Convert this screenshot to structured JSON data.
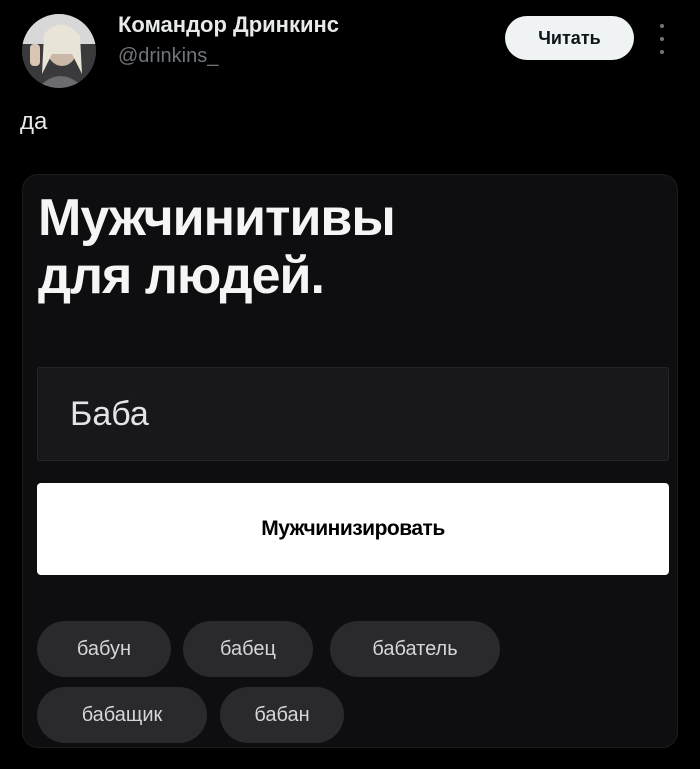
{
  "author": {
    "name": "Командор Дринкинс",
    "handle": "@drinkins_"
  },
  "follow_button_label": "Читать",
  "tweet_text": "да",
  "card": {
    "heading_line1": "Мужчинитивы",
    "heading_line2": "для людей.",
    "input_value": "Баба",
    "submit_label": "Мужчинизировать",
    "suggestions": [
      "бабун",
      "бабец",
      "бабатель",
      "бабащик",
      "бабан"
    ]
  },
  "colors": {
    "background": "#000000",
    "card_background": "#0e0e10",
    "button_background": "#ffffff",
    "chip_background": "#2a2a2d",
    "handle_text": "#71767b"
  }
}
